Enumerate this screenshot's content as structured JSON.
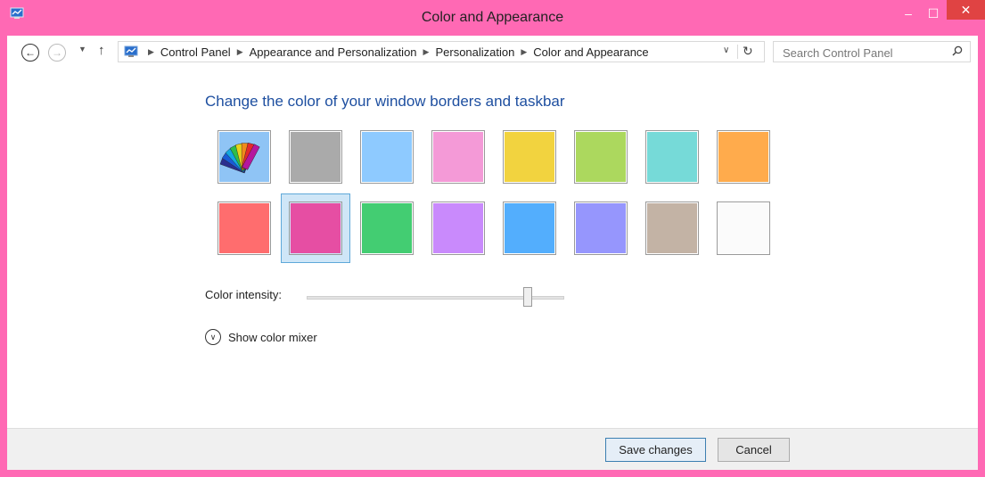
{
  "window": {
    "title": "Color and Appearance",
    "frame_color": "#ff69b4",
    "controls": {
      "minimize": "–",
      "maximize": "☐",
      "close": "✕"
    }
  },
  "nav": {
    "back_icon": "←",
    "forward_icon": "→",
    "recent_icon": "▼",
    "up_icon": "↑",
    "breadcrumbs": [
      "Control Panel",
      "Appearance and Personalization",
      "Personalization",
      "Color and Appearance"
    ],
    "dropdown_icon": "∨",
    "refresh_icon": "↻",
    "search_placeholder": "Search Control Panel"
  },
  "main": {
    "heading": "Change the color of your window borders and taskbar",
    "swatches": [
      {
        "name": "automatic",
        "color": "#8fc4f5"
      },
      {
        "name": "gray",
        "color": "#aaaaaa"
      },
      {
        "name": "light-blue",
        "color": "#8ecaff"
      },
      {
        "name": "pink",
        "color": "#f49ad7"
      },
      {
        "name": "yellow",
        "color": "#f2d33f"
      },
      {
        "name": "green",
        "color": "#acd85e"
      },
      {
        "name": "teal",
        "color": "#76dad8"
      },
      {
        "name": "orange",
        "color": "#ffab4c"
      },
      {
        "name": "red",
        "color": "#ff6d6e"
      },
      {
        "name": "magenta",
        "color": "#e64ea3",
        "selected": true
      },
      {
        "name": "emerald",
        "color": "#43cd72"
      },
      {
        "name": "violet",
        "color": "#c98afc"
      },
      {
        "name": "blue",
        "color": "#53aefd"
      },
      {
        "name": "periwinkle",
        "color": "#9696fd"
      },
      {
        "name": "taupe",
        "color": "#c3b3a5"
      },
      {
        "name": "white",
        "color": "#fbfbfb"
      }
    ],
    "intensity_label": "Color intensity:",
    "intensity_value": 0.87,
    "mixer_label": "Show color mixer",
    "mixer_icon": "∨"
  },
  "footer": {
    "save_label": "Save changes",
    "cancel_label": "Cancel"
  }
}
